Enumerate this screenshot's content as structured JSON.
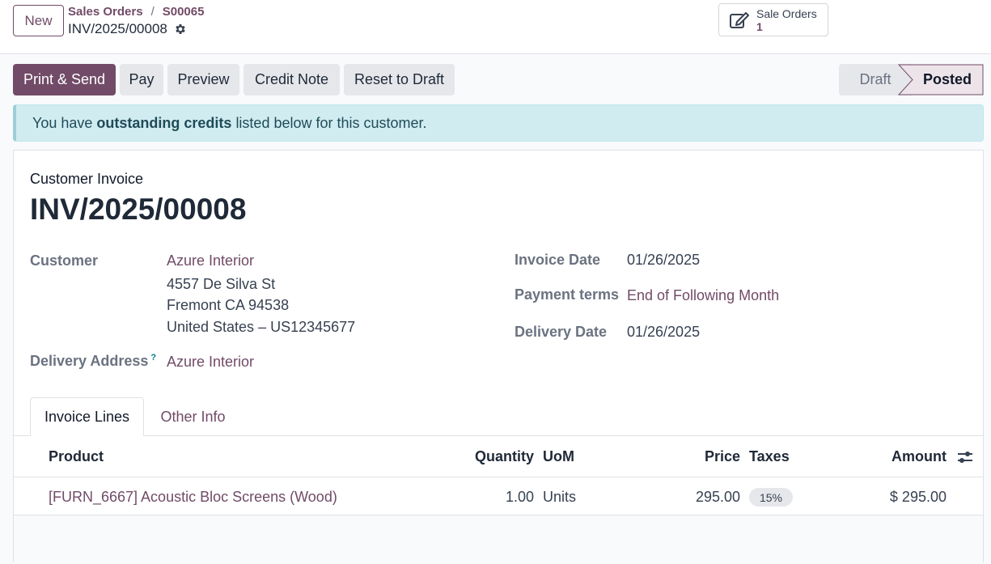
{
  "header": {
    "new_label": "New",
    "breadcrumb": [
      "Sales Orders",
      "S00065"
    ],
    "breadcrumb_sep": "/",
    "record_title": "INV/2025/00008",
    "smart_button": {
      "label": "Sale Orders",
      "count": "1"
    }
  },
  "actions": {
    "print_send": "Print & Send",
    "pay": "Pay",
    "preview": "Preview",
    "credit_note": "Credit Note",
    "reset_to_draft": "Reset to Draft"
  },
  "status": {
    "draft": "Draft",
    "posted": "Posted",
    "current": "Posted"
  },
  "alert": {
    "prefix": "You have",
    "bold": "outstanding credits",
    "suffix": "listed below for this customer."
  },
  "invoice": {
    "type": "Customer Invoice",
    "name": "INV/2025/00008",
    "customer_label": "Customer",
    "customer_name": "Azure Interior",
    "address_line1": "4557 De Silva St",
    "address_line2": "Fremont CA 94538",
    "address_line3": "United States – US12345677",
    "delivery_address_label": "Delivery Address",
    "delivery_address_help": "?",
    "delivery_address": "Azure Interior",
    "invoice_date_label": "Invoice Date",
    "invoice_date": "01/26/2025",
    "payment_terms_label": "Payment terms",
    "payment_terms": "End of Following Month",
    "delivery_date_label": "Delivery Date",
    "delivery_date": "01/26/2025"
  },
  "tabs": [
    {
      "label": "Invoice Lines",
      "active": true
    },
    {
      "label": "Other Info",
      "active": false
    }
  ],
  "table": {
    "columns": [
      "Product",
      "Quantity",
      "UoM",
      "Price",
      "Taxes",
      "Amount"
    ],
    "rows": [
      {
        "product": "[FURN_6667] Acoustic Bloc Screens (Wood)",
        "quantity": "1.00",
        "uom": "Units",
        "price": "295.00",
        "taxes": "15%",
        "amount": "$ 295.00"
      }
    ]
  },
  "colors": {
    "brand": "#714b67",
    "alert_bg": "#d1ecf1",
    "link": "#714b67"
  },
  "icons": [
    "gear-icon",
    "edit-icon",
    "optional-columns-icon"
  ]
}
